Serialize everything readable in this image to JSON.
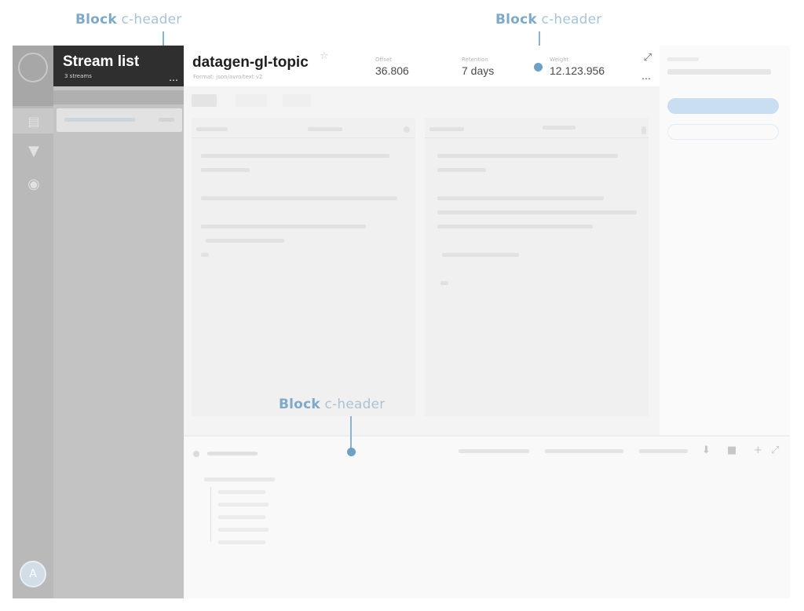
{
  "callouts": {
    "top_left": {
      "strong": "Block",
      "rest": "c-header"
    },
    "top_right": {
      "strong": "Block",
      "rest": "c-header"
    },
    "bottom": {
      "strong": "Block",
      "rest": "c-header"
    }
  },
  "sidebar": {
    "title": "Stream list",
    "subtitle": "3 streams",
    "more_icon": "more-horizontal-icon"
  },
  "rail": {
    "icons": [
      "logo-icon",
      "streams-icon",
      "filter-icon",
      "globe-icon"
    ],
    "avatar_initial": "A"
  },
  "header": {
    "topic_title": "datagen-gl-topic",
    "topic_subtitle": "Format: json/avro/text v2",
    "star_icon": "star-icon",
    "metrics": [
      {
        "label": "Offset",
        "value": "36.806"
      },
      {
        "label": "Retention",
        "value": "7 days"
      },
      {
        "label": "Weight",
        "value": "12.123.956"
      }
    ],
    "expand_icon": "expand-icon",
    "more_icon": "more-horizontal-icon"
  },
  "colors": {
    "callout_accent": "#7ea9c8",
    "dark_header": "#2f2f2f",
    "pill_blue": "#c9def0"
  }
}
